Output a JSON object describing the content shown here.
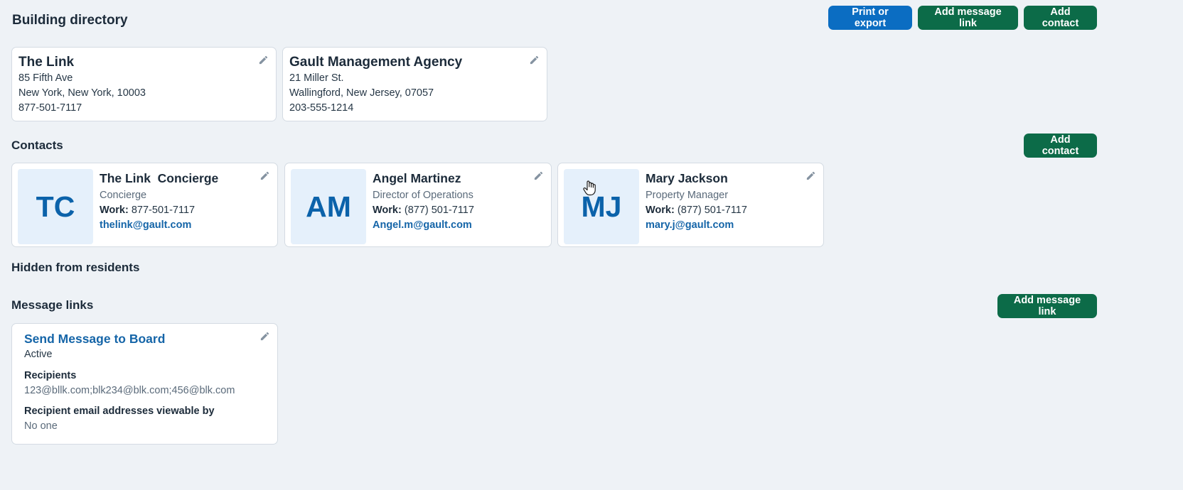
{
  "header": {
    "title": "Building directory",
    "buttons": {
      "print_export": "Print or export",
      "add_message_link": "Add message link",
      "add_contact": "Add contact"
    }
  },
  "organizations": [
    {
      "name": "The Link",
      "address": "85 Fifth Ave",
      "city_state_zip": "New York, New York, 10003",
      "phone": "877-501-7117"
    },
    {
      "name": "Gault Management Agency",
      "address": "21 Miller St.",
      "city_state_zip": "Wallingford, New Jersey, 07057",
      "phone": "203-555-1214"
    }
  ],
  "contacts_section": {
    "title": "Contacts",
    "add_button": "Add contact",
    "work_label": "Work:",
    "items": [
      {
        "initials": "TC",
        "name": "The Link  Concierge",
        "role": "Concierge",
        "work_phone": "877-501-7117",
        "email": "thelink@gault.com"
      },
      {
        "initials": "AM",
        "name": "Angel Martinez",
        "role": "Director of Operations",
        "work_phone": "(877) 501-7117",
        "email": "Angel.m@gault.com"
      },
      {
        "initials": "MJ",
        "name": "Mary Jackson",
        "role": "Property Manager",
        "work_phone": "(877) 501-7117",
        "email": "mary.j@gault.com"
      }
    ]
  },
  "hidden_section": {
    "title": "Hidden from residents"
  },
  "message_links_section": {
    "title": "Message links",
    "add_button": "Add message link",
    "items": [
      {
        "title": "Send Message to Board",
        "status": "Active",
        "recipients_label": "Recipients",
        "recipients": "123@bllk.com;blk234@blk.com;456@blk.com",
        "viewable_label": "Recipient email addresses viewable by",
        "viewable_value": "No one"
      }
    ]
  },
  "icons": {
    "edit": "pencil-icon",
    "cursor": "hand-cursor-icon"
  },
  "colors": {
    "primary_blue": "#0b6dc2",
    "primary_green": "#0c6b48",
    "link_blue": "#1565a8",
    "avatar_bg": "#e5f0fb",
    "page_bg": "#eef2f6"
  }
}
